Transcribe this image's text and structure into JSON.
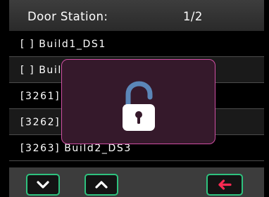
{
  "header": {
    "title": "Door Station:",
    "page": "1/2"
  },
  "list": {
    "rows": [
      "[ ]  Build1_DS1",
      "[ ]  Build1_DS2",
      "[3261]  Build2_DS1",
      "[3262]  Build2_DS2",
      "[3263]  Build2_DS3"
    ]
  },
  "footer": {
    "down_icon": "chevron-down-icon",
    "up_icon": "chevron-up-icon",
    "back_icon": "back-arrow-icon"
  },
  "modal": {
    "icon": "unlock-icon"
  },
  "colors": {
    "button_border": "#2ec27e",
    "back_arrow": "#ff2a52",
    "modal_border": "#d04ea3",
    "modal_background": "#35192b",
    "lock_shackle": "#5b86b8"
  }
}
